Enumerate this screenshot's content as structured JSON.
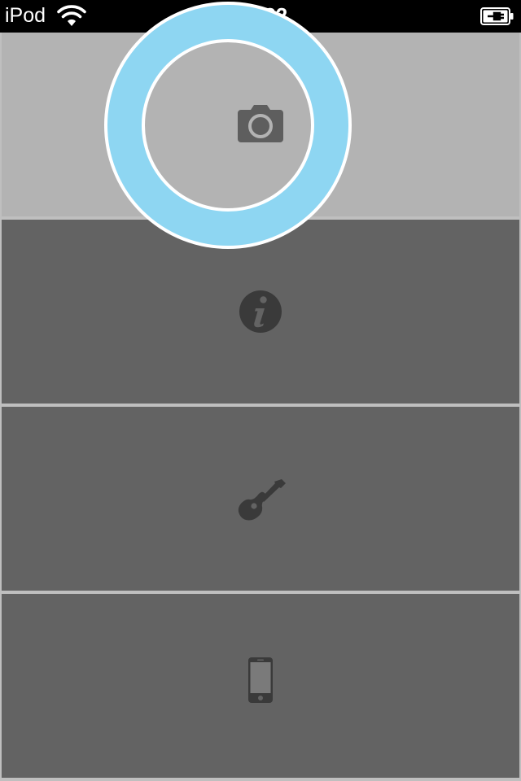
{
  "status_bar": {
    "carrier": "iPod",
    "time": "13:22",
    "wifi_icon": "wifi-icon",
    "battery_icon": "battery-charging-icon"
  },
  "menu": {
    "selected_index": 0,
    "items": [
      {
        "icon": "camera-icon",
        "selected": true
      },
      {
        "icon": "info-icon",
        "selected": false
      },
      {
        "icon": "guitar-icon",
        "selected": false
      },
      {
        "icon": "iphone-icon",
        "selected": false
      }
    ]
  },
  "colors": {
    "status_bar_bg": "#000000",
    "row_bg": "#636363",
    "row_selected_bg": "#b3b3b3",
    "divider": "#bfbfbf",
    "icon": "#3a3a3a",
    "highlight_ring": "#8ed6f2",
    "highlight_ring_border": "#ffffff"
  }
}
